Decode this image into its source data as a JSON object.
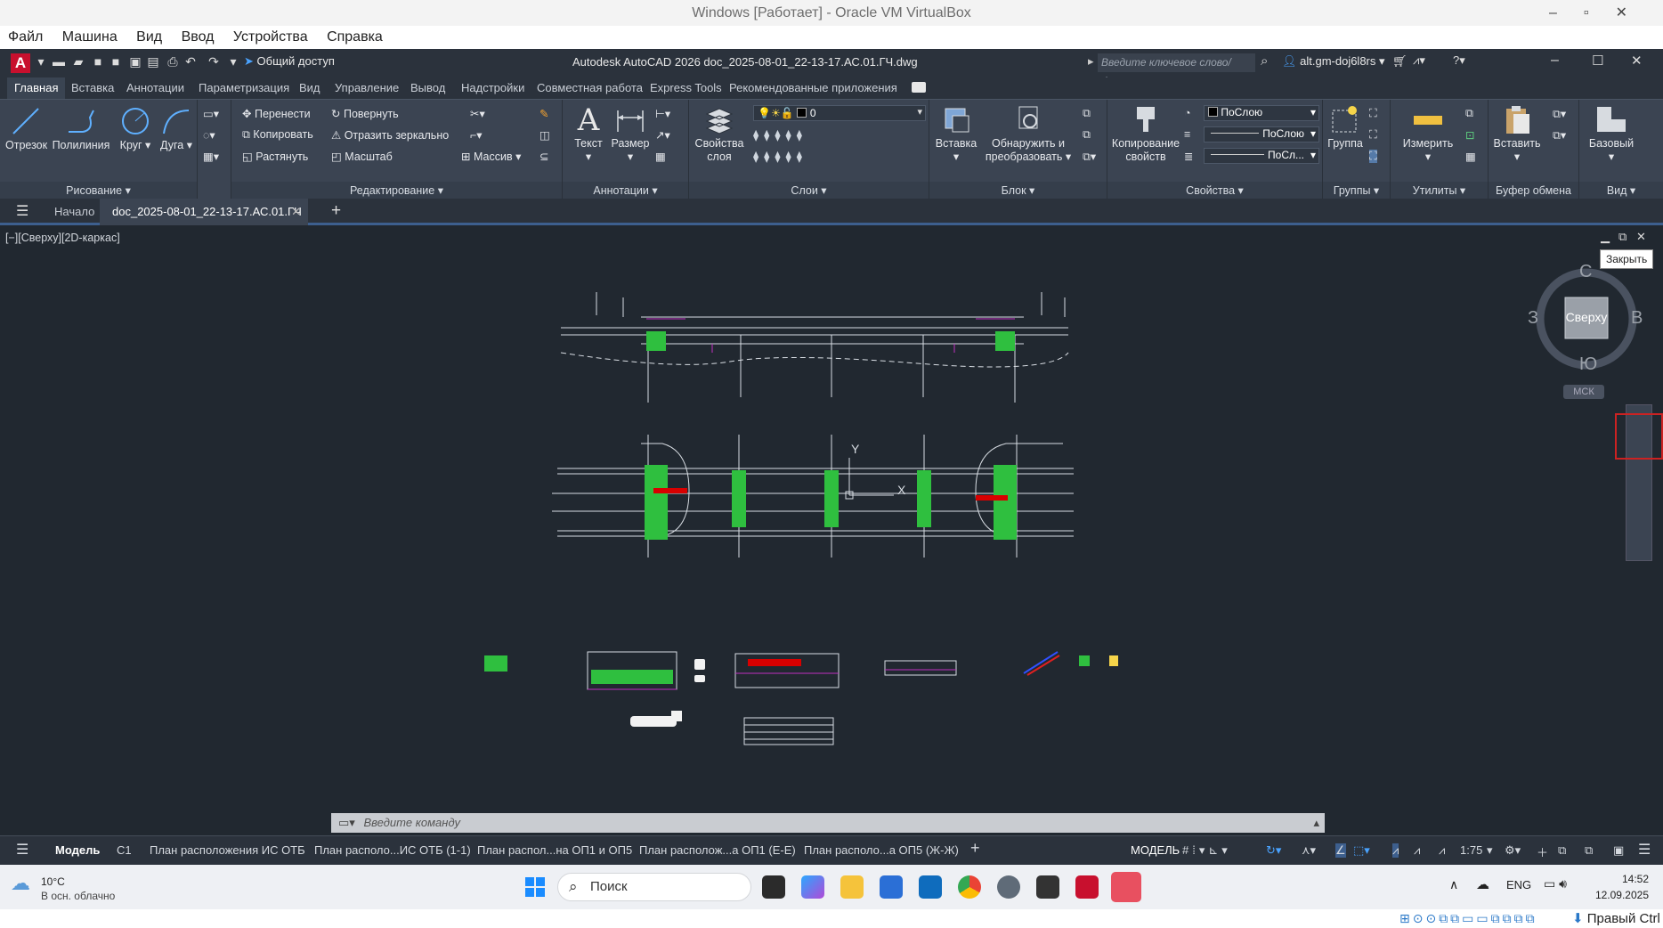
{
  "vbox": {
    "title": "Windows [Работает] - Oracle VM VirtualBox",
    "menu": [
      "Файл",
      "Машина",
      "Вид",
      "Ввод",
      "Устройства",
      "Справка"
    ],
    "host_key": "Правый Ctrl"
  },
  "acad": {
    "title": "Autodesk AutoCAD 2026    doc_2025-08-01_22-13-17.АС.01.ГЧ.dwg",
    "share": "Общий доступ",
    "search_placeholder": "Введите ключевое слово/фразу",
    "user": "alt.gm-doj6l8rs",
    "ribbon_tabs": [
      "Главная",
      "Вставка",
      "Аннотации",
      "Параметризация",
      "Вид",
      "Управление",
      "Вывод",
      "Надстройки",
      "Совместная работа",
      "Express Tools",
      "Рекомендованные приложения"
    ],
    "draw": {
      "label": "Рисование",
      "line": "Отрезок",
      "polyline": "Полилиния",
      "circle": "Круг",
      "arc": "Дуга"
    },
    "modify": {
      "label": "Редактирование",
      "move": "Перенести",
      "rotate": "Повернуть",
      "copy": "Копировать",
      "mirror": "Отразить зеркально",
      "stretch": "Растянуть",
      "scale": "Масштаб",
      "array": "Массив"
    },
    "annotation": {
      "label": "Аннотации",
      "text": "Текст",
      "dimension": "Размер"
    },
    "layers": {
      "label": "Слои",
      "props": "Свойства слоя",
      "current": "0"
    },
    "block": {
      "label": "Блок",
      "insert": "Вставка",
      "detect": "Обнаружить и преобразовать"
    },
    "properties": {
      "label": "Свойства",
      "match": "Копирование свойств",
      "color": "ПоСлою",
      "lineweight": "ПоСлою",
      "linetype": "ПоСл..."
    },
    "groups": {
      "label": "Группы",
      "group": "Группа"
    },
    "utilities": {
      "label": "Утилиты",
      "measure": "Измерить"
    },
    "clipboard": {
      "label": "Буфер обмена",
      "paste": "Вставить"
    },
    "view": {
      "label": "Вид",
      "base": "Базовый"
    },
    "doc_tabs": {
      "start": "Начало",
      "current": "doc_2025-08-01_22-13-17.АС.01.ГЧ *"
    },
    "viewport_label": "[−][Сверху][2D-каркас]",
    "viewcube": {
      "n": "С",
      "s": "Ю",
      "e": "В",
      "w": "З",
      "top": "Сверху",
      "wcs": "МСК"
    },
    "tooltip_close": "Закрыть",
    "ucs": {
      "x": "X",
      "y": "Y"
    },
    "command_placeholder": "Введите команду",
    "layout_tabs": [
      "Модель",
      "С1",
      "План расположения ИС ОТБ",
      "План располо...ИС ОТБ (1-1)",
      "План распол...на ОП1 и ОП5",
      "План располож...а ОП1 (Е-Е)",
      "План располо...а ОП5 (Ж-Ж)"
    ],
    "status": {
      "model": "МОДЕЛЬ",
      "scale": "1:75"
    }
  },
  "taskbar": {
    "weather_temp": "10°C",
    "weather_desc": "В осн. облачно",
    "search": "Поиск",
    "lang": "ENG",
    "time": "14:52",
    "date": "12.09.2025"
  }
}
